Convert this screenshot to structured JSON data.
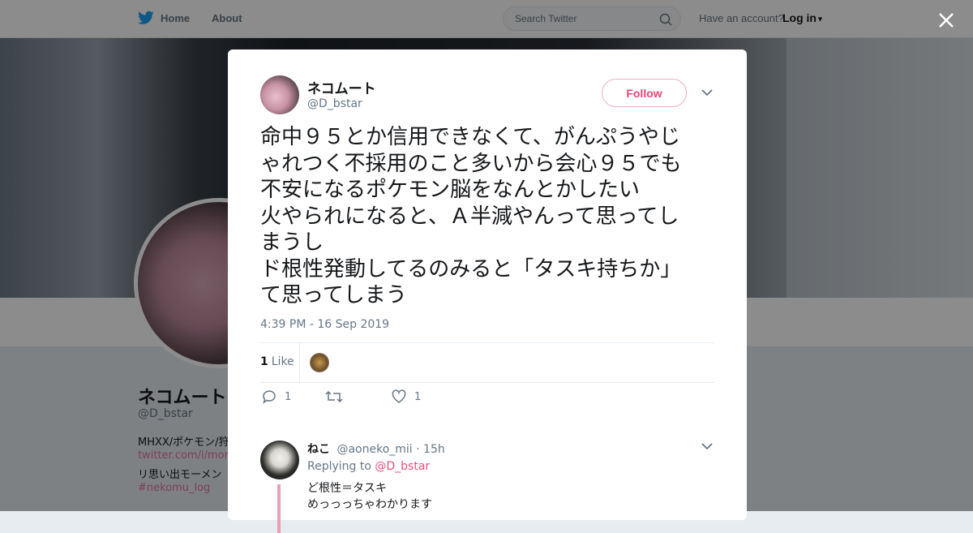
{
  "nav": {
    "home_label": "Home",
    "about_label": "About",
    "search_placeholder": "Search Twitter",
    "account_prompt": "Have an account?",
    "login_label": "Log in"
  },
  "profile": {
    "name": "ネコムート",
    "handle": "@D_bstar",
    "bio_line1": "MHXX/ポケモン/狩",
    "bio_link": "twitter.com/i/mom",
    "bio_line3": "リ思い出モーメン",
    "hashtag": "#nekomu_log"
  },
  "tweet": {
    "author_name": "ネコムート",
    "author_handle": "@D_bstar",
    "follow_label": "Follow",
    "text": "命中９５とか信用できなくて、がんぷうやじ\nゃれつく不採用のこと多いから会心９５でも\n不安になるポケモン脳をなんとかしたい\n火やられになると、Ａ半減やんって思ってし\nまうし\nド根性発動してるのみると「タスキ持ちか」\nて思ってしまう",
    "timestamp": "4:39 PM - 16 Sep 2019",
    "like_count": "1",
    "like_label": "Like",
    "reply_count": "1",
    "fav_count": "1"
  },
  "reply": {
    "name": "ねこ",
    "handle": "@aoneko_mii",
    "time": "· 15h",
    "replying_prefix": "Replying to",
    "replying_to": "@D_bstar",
    "line1": "ど根性＝タスキ",
    "line2": "めっっっちゃわかります"
  },
  "colors": {
    "brand": "#1da1f2",
    "accent": "#e0245e"
  }
}
